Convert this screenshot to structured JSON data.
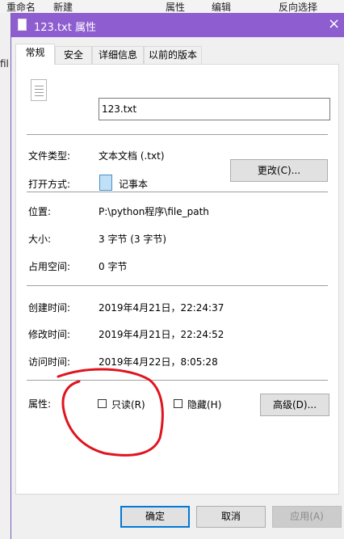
{
  "background": {
    "toolbar_items": [
      "重命名",
      "新建",
      "属性",
      "编辑",
      "反向选择"
    ],
    "left_fragment": "fil"
  },
  "window": {
    "title": "123.txt 属性",
    "close_glyph": "×",
    "accent": "#8e5ed0"
  },
  "tabs": [
    {
      "label": "常规",
      "active": true
    },
    {
      "label": "安全",
      "active": false
    },
    {
      "label": "详细信息",
      "active": false
    },
    {
      "label": "以前的版本",
      "active": false
    }
  ],
  "general": {
    "filename": "123.txt",
    "file_type_label": "文件类型:",
    "file_type_value": "文本文档 (.txt)",
    "opens_with_label": "打开方式:",
    "opens_with_app": "记事本",
    "change_button": "更改(C)...",
    "location_label": "位置:",
    "location_value": "P:\\python程序\\file_path",
    "size_label": "大小:",
    "size_value": "3 字节 (3 字节)",
    "size_on_disk_label": "占用空间:",
    "size_on_disk_value": "0 字节",
    "created_label": "创建时间:",
    "created_value": "2019年4月21日，22:24:37",
    "modified_label": "修改时间:",
    "modified_value": "2019年4月21日，22:24:52",
    "accessed_label": "访问时间:",
    "accessed_value": "2019年4月22日，8:05:28",
    "attributes_label": "属性:",
    "readonly_label": "只读(R)",
    "hidden_label": "隐藏(H)",
    "advanced_button": "高级(D)..."
  },
  "footer": {
    "ok": "确定",
    "cancel": "取消",
    "apply": "应用(A)"
  },
  "annotation": {
    "color": "#e0141e"
  }
}
